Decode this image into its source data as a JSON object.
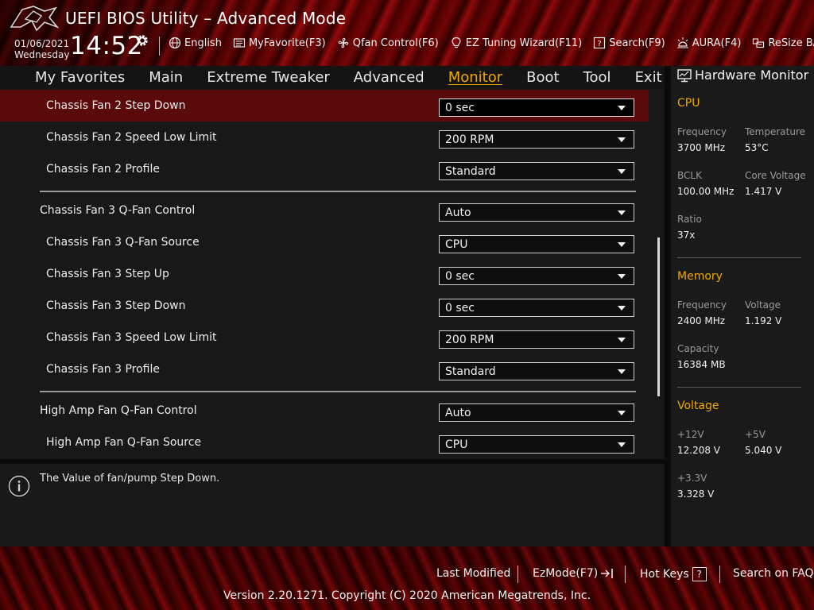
{
  "header": {
    "title": "UEFI BIOS Utility – Advanced Mode",
    "date": "01/06/2021",
    "weekday": "Wednesday",
    "time": "14:52",
    "logo_icon": "rog-logo-icon",
    "toolbar": [
      {
        "label": "English",
        "icon": "globe-icon"
      },
      {
        "label": "MyFavorite(F3)",
        "icon": "favorite-list-icon"
      },
      {
        "label": "Qfan Control(F6)",
        "icon": "fan-icon"
      },
      {
        "label": "EZ Tuning Wizard(F11)",
        "icon": "bulb-icon"
      },
      {
        "label": "Search(F9)",
        "icon": "question-box-icon"
      },
      {
        "label": "AURA(F4)",
        "icon": "aura-light-icon"
      },
      {
        "label": "ReSize BAR",
        "icon": "resize-bar-icon"
      }
    ]
  },
  "nav": {
    "tabs": [
      "My Favorites",
      "Main",
      "Extreme Tweaker",
      "Advanced",
      "Monitor",
      "Boot",
      "Tool",
      "Exit"
    ],
    "active": "Monitor"
  },
  "settings": [
    {
      "label": "Chassis Fan 2 Step Down",
      "value": "0 sec",
      "selected": true
    },
    {
      "label": "Chassis Fan 2 Speed Low Limit",
      "value": "200 RPM"
    },
    {
      "label": "Chassis Fan 2 Profile",
      "value": "Standard"
    },
    {
      "label": "Chassis Fan 3 Q-Fan Control",
      "value": "Auto"
    },
    {
      "label": "Chassis Fan 3 Q-Fan Source",
      "value": "CPU"
    },
    {
      "label": "Chassis Fan 3 Step Up",
      "value": "0 sec"
    },
    {
      "label": "Chassis Fan 3 Step Down",
      "value": "0 sec"
    },
    {
      "label": "Chassis Fan 3 Speed Low Limit",
      "value": "200 RPM"
    },
    {
      "label": "Chassis Fan 3 Profile",
      "value": "Standard"
    },
    {
      "label": "High Amp Fan Q-Fan Control",
      "value": "Auto"
    },
    {
      "label": "High Amp Fan Q-Fan Source",
      "value": "CPU"
    }
  ],
  "help": {
    "icon": "info-icon",
    "text": "The Value of fan/pump Step Down."
  },
  "hardware_monitor": {
    "title": "Hardware Monitor",
    "icon": "monitor-icon",
    "cpu": {
      "section": "CPU",
      "frequency_label": "Frequency",
      "frequency": "3700 MHz",
      "temperature_label": "Temperature",
      "temperature": "53°C",
      "bclk_label": "BCLK",
      "bclk": "100.00 MHz",
      "core_voltage_label": "Core Voltage",
      "core_voltage": "1.417 V",
      "ratio_label": "Ratio",
      "ratio": "37x"
    },
    "memory": {
      "section": "Memory",
      "frequency_label": "Frequency",
      "frequency": "2400 MHz",
      "voltage_label": "Voltage",
      "voltage": "1.192 V",
      "capacity_label": "Capacity",
      "capacity": "16384 MB"
    },
    "voltage": {
      "section": "Voltage",
      "v12_label": "+12V",
      "v12": "12.208 V",
      "v5_label": "+5V",
      "v5": "5.040 V",
      "v33_label": "+3.3V",
      "v33": "3.328 V"
    }
  },
  "footer": {
    "last_modified": "Last Modified",
    "ezmode": "EzMode(F7)",
    "ezmode_icon": "exit-arrow-icon",
    "hotkeys": "Hot Keys",
    "hotkeys_box": "?",
    "faq": "Search on FAQ",
    "copyright": "Version 2.20.1271. Copyright (C) 2020 American Megatrends, Inc."
  },
  "colors": {
    "accent": "#f0a800",
    "selected_row": "#5a0a0a",
    "panel": "#181818"
  }
}
